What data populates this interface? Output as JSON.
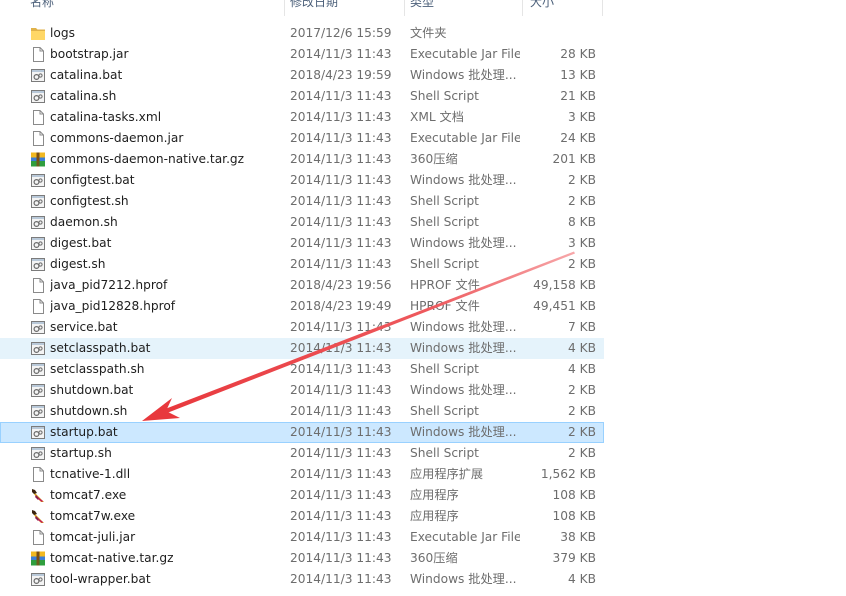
{
  "columns": {
    "name": "名称",
    "date": "修改日期",
    "type": "类型",
    "size": "大小"
  },
  "files": [
    {
      "name": "logs",
      "date": "2017/12/6 15:59",
      "type": "文件夹",
      "size": "",
      "icon": "folder-icon"
    },
    {
      "name": "bootstrap.jar",
      "date": "2014/11/3 11:43",
      "type": "Executable Jar File",
      "size": "28 KB",
      "icon": "file-icon"
    },
    {
      "name": "catalina.bat",
      "date": "2018/4/23 19:59",
      "type": "Windows 批处理...",
      "size": "13 KB",
      "icon": "script-icon"
    },
    {
      "name": "catalina.sh",
      "date": "2014/11/3 11:43",
      "type": "Shell Script",
      "size": "21 KB",
      "icon": "script-icon"
    },
    {
      "name": "catalina-tasks.xml",
      "date": "2014/11/3 11:43",
      "type": "XML 文档",
      "size": "3 KB",
      "icon": "file-icon"
    },
    {
      "name": "commons-daemon.jar",
      "date": "2014/11/3 11:43",
      "type": "Executable Jar File",
      "size": "24 KB",
      "icon": "file-icon"
    },
    {
      "name": "commons-daemon-native.tar.gz",
      "date": "2014/11/3 11:43",
      "type": "360压缩",
      "size": "201 KB",
      "icon": "archive-icon"
    },
    {
      "name": "configtest.bat",
      "date": "2014/11/3 11:43",
      "type": "Windows 批处理...",
      "size": "2 KB",
      "icon": "script-icon"
    },
    {
      "name": "configtest.sh",
      "date": "2014/11/3 11:43",
      "type": "Shell Script",
      "size": "2 KB",
      "icon": "script-icon"
    },
    {
      "name": "daemon.sh",
      "date": "2014/11/3 11:43",
      "type": "Shell Script",
      "size": "8 KB",
      "icon": "script-icon"
    },
    {
      "name": "digest.bat",
      "date": "2014/11/3 11:43",
      "type": "Windows 批处理...",
      "size": "3 KB",
      "icon": "script-icon"
    },
    {
      "name": "digest.sh",
      "date": "2014/11/3 11:43",
      "type": "Shell Script",
      "size": "2 KB",
      "icon": "script-icon"
    },
    {
      "name": "java_pid7212.hprof",
      "date": "2018/4/23 19:56",
      "type": "HPROF 文件",
      "size": "49,158 KB",
      "icon": "file-icon"
    },
    {
      "name": "java_pid12828.hprof",
      "date": "2018/4/23 19:49",
      "type": "HPROF 文件",
      "size": "49,451 KB",
      "icon": "file-icon"
    },
    {
      "name": "service.bat",
      "date": "2014/11/3 11:43",
      "type": "Windows 批处理...",
      "size": "7 KB",
      "icon": "script-icon"
    },
    {
      "name": "setclasspath.bat",
      "date": "2014/11/3 11:43",
      "type": "Windows 批处理...",
      "size": "4 KB",
      "icon": "script-icon",
      "state": "hover"
    },
    {
      "name": "setclasspath.sh",
      "date": "2014/11/3 11:43",
      "type": "Shell Script",
      "size": "4 KB",
      "icon": "script-icon"
    },
    {
      "name": "shutdown.bat",
      "date": "2014/11/3 11:43",
      "type": "Windows 批处理...",
      "size": "2 KB",
      "icon": "script-icon"
    },
    {
      "name": "shutdown.sh",
      "date": "2014/11/3 11:43",
      "type": "Shell Script",
      "size": "2 KB",
      "icon": "script-icon"
    },
    {
      "name": "startup.bat",
      "date": "2014/11/3 11:43",
      "type": "Windows 批处理...",
      "size": "2 KB",
      "icon": "script-icon",
      "state": "selected"
    },
    {
      "name": "startup.sh",
      "date": "2014/11/3 11:43",
      "type": "Shell Script",
      "size": "2 KB",
      "icon": "script-icon"
    },
    {
      "name": "tcnative-1.dll",
      "date": "2014/11/3 11:43",
      "type": "应用程序扩展",
      "size": "1,562 KB",
      "icon": "file-icon"
    },
    {
      "name": "tomcat7.exe",
      "date": "2014/11/3 11:43",
      "type": "应用程序",
      "size": "108 KB",
      "icon": "tomcat-icon"
    },
    {
      "name": "tomcat7w.exe",
      "date": "2014/11/3 11:43",
      "type": "应用程序",
      "size": "108 KB",
      "icon": "tomcat-icon"
    },
    {
      "name": "tomcat-juli.jar",
      "date": "2014/11/3 11:43",
      "type": "Executable Jar File",
      "size": "38 KB",
      "icon": "file-icon"
    },
    {
      "name": "tomcat-native.tar.gz",
      "date": "2014/11/3 11:43",
      "type": "360压缩",
      "size": "379 KB",
      "icon": "archive-icon"
    },
    {
      "name": "tool-wrapper.bat",
      "date": "2014/11/3 11:43",
      "type": "Windows 批处理...",
      "size": "4 KB",
      "icon": "script-icon"
    }
  ],
  "colors": {
    "selected_bg": "#cce8ff",
    "selected_border": "#99d1ff",
    "hover_bg": "#e5f3fb",
    "header_text": "#4c607a",
    "annotation_arrow": "#e8383d"
  }
}
